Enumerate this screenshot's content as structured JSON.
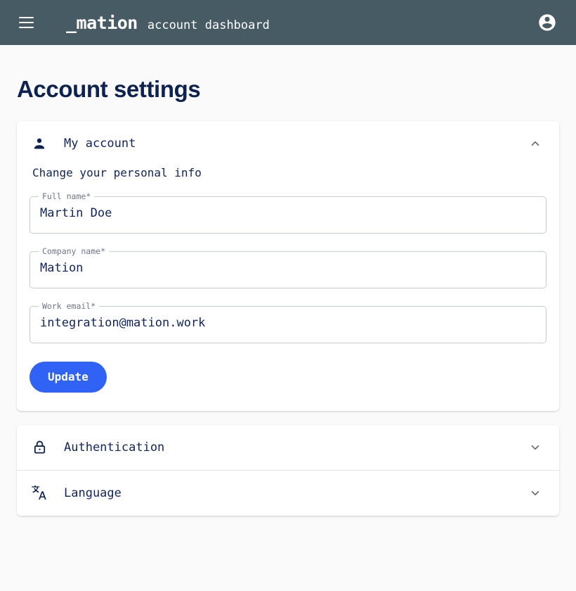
{
  "header": {
    "menu_icon": "hamburger-menu-icon",
    "logo_text": "_mation",
    "subtitle": "account dashboard",
    "avatar_icon": "account-circle-icon",
    "background_color": "#475b64"
  },
  "page": {
    "title": "Account settings",
    "title_color": "#0e2250",
    "background_color": "#fafafa"
  },
  "my_account": {
    "icon": "person-icon",
    "title": "My account",
    "expanded": true,
    "chevron_icon": "chevron-up-icon",
    "subtitle": "Change your personal info",
    "fields": [
      {
        "name": "full-name",
        "label": "Full name",
        "required_marker": "*",
        "value": "Martin Doe",
        "placeholder": "Full name"
      },
      {
        "name": "company-name",
        "label": "Company name",
        "required_marker": "*",
        "value": "Mation",
        "placeholder": "Company name"
      },
      {
        "name": "work-email",
        "label": "Work email",
        "required_marker": "*",
        "value": "integration@mation.work",
        "placeholder": "Work email"
      }
    ],
    "update_button": {
      "label": "Update",
      "color": "#2f62f5"
    }
  },
  "sections": [
    {
      "name": "authentication",
      "icon": "lock-icon",
      "title": "Authentication",
      "expanded": false,
      "chevron_icon": "chevron-down-icon"
    },
    {
      "name": "language",
      "icon": "translate-icon",
      "title": "Language",
      "expanded": false,
      "chevron_icon": "chevron-down-icon"
    }
  ]
}
